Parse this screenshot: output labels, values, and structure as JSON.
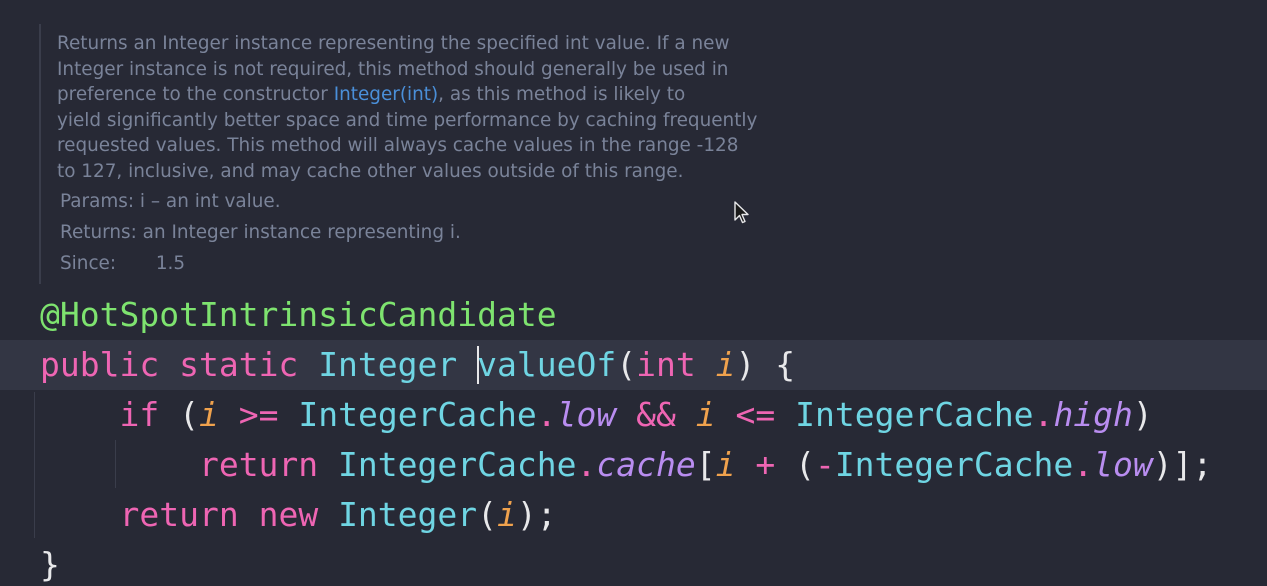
{
  "doc": {
    "desc_lines": [
      "Returns an Integer instance representing the specified int value. If a new",
      "Integer instance is not required, this method should generally be used in",
      "preference to the constructor ",
      "yield significantly better space and time performance by caching frequently",
      "requested values. This method will always cache values in the range -128",
      "to 127, inclusive, and may cache other values outside of this range."
    ],
    "link_text": "Integer(int)",
    "line3_suffix": ", as this method is likely to",
    "params_tag": "Params:",
    "params_value": "i – an int value.",
    "returns_tag": "Returns:",
    "returns_value": "an Integer instance representing i.",
    "since_tag": "Since:",
    "since_value": "1.5"
  },
  "code": {
    "annotation": "@HotSpotIntrinsicCandidate",
    "line2": {
      "public": "public",
      "static": "static",
      "ret_type": "Integer",
      "method_name": "valueOf",
      "open_paren": "(",
      "param_type": "int",
      "param_name": "i",
      "close": ") {"
    },
    "line3": {
      "if": "if",
      "open": "(",
      "i1": "i",
      "ge": ">=",
      "cls1": "IntegerCache",
      "dot1": ".",
      "low1": "low",
      "and": "&&",
      "i2": "i",
      "le": "<=",
      "cls2": "IntegerCache",
      "dot2": ".",
      "high": "high",
      "close": ")"
    },
    "line4": {
      "return": "return",
      "cls1": "IntegerCache",
      "dot1": ".",
      "cache": "cache",
      "bracket": "[",
      "i": "i",
      "plus": "+",
      "paren_open": "(",
      "minus": "-",
      "cls2": "IntegerCache",
      "dot2": ".",
      "low": "low",
      "end": ")];"
    },
    "line5": {
      "return": "return",
      "new": "new",
      "type": "Integer",
      "open": "(",
      "i": "i",
      "end": ");"
    },
    "line6": "}"
  },
  "colors": {
    "background": "#272935",
    "current_line": "#333644",
    "annotation": "#7ee36f",
    "keyword": "#ee65b3",
    "type": "#6fd5e3",
    "parameter": "#f0a24d",
    "field": "#b98df0",
    "doc_text": "#7a8399",
    "doc_link": "#4a8fd9"
  }
}
